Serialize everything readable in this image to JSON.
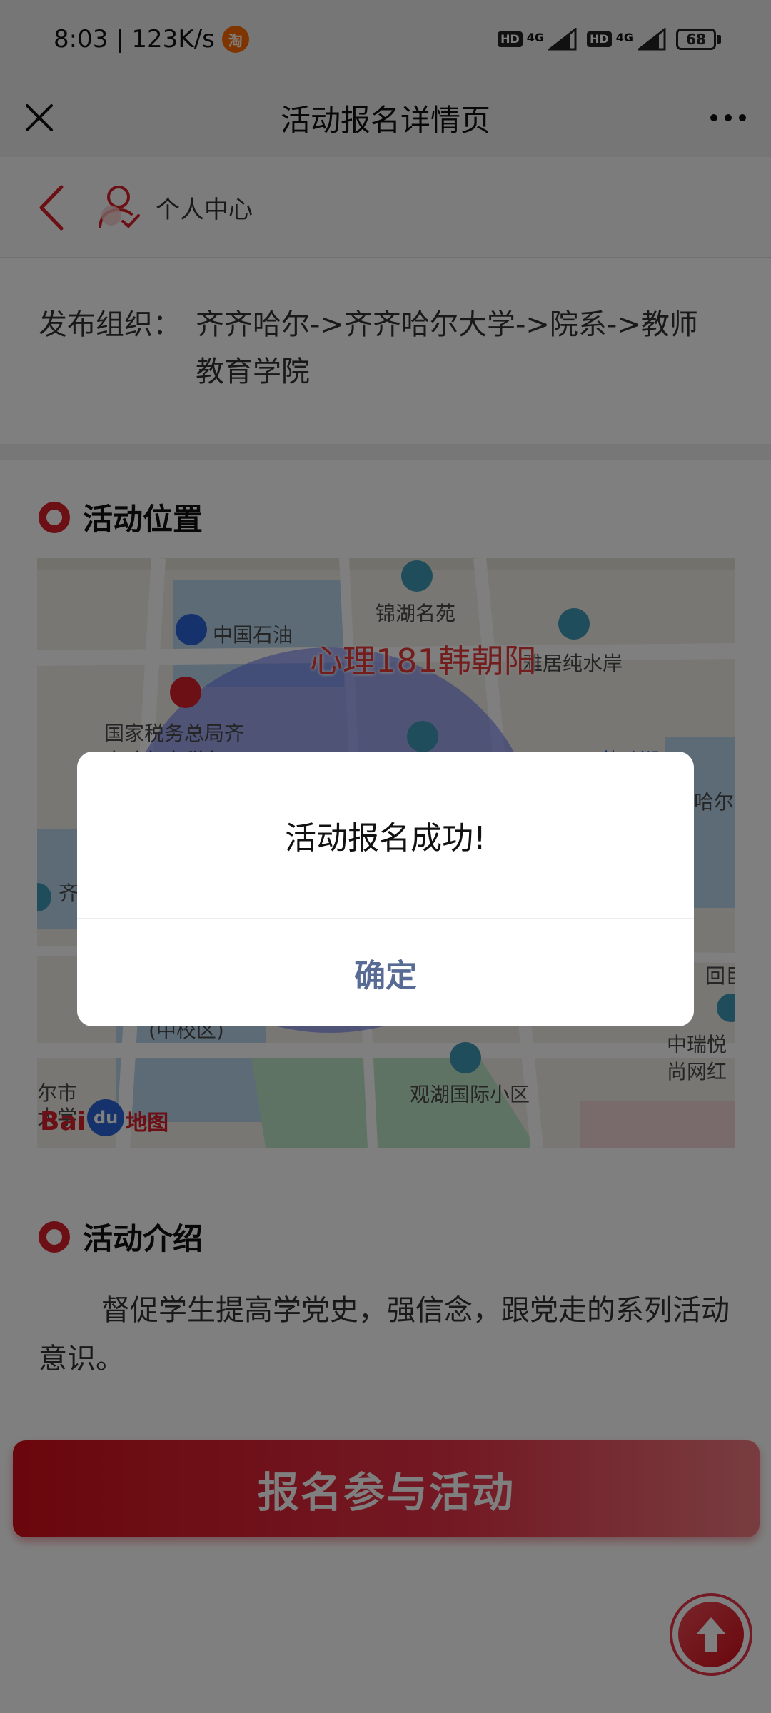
{
  "status_bar": {
    "time_speed": "8:03 | 123K/s",
    "taobao_badge": "淘",
    "hd_1": "HD",
    "net_1": "4G",
    "hd_2": "HD",
    "net_2": "4G",
    "battery": "68"
  },
  "title_bar": {
    "title": "活动报名详情页"
  },
  "sub_nav": {
    "label": "个人中心"
  },
  "org": {
    "label": "发布组织：",
    "value": "齐齐哈尔->齐齐哈尔大学->院系->教师教育学院"
  },
  "location_section": {
    "title": "活动位置"
  },
  "map": {
    "marker_label": "心理181韩朝阳",
    "labels": {
      "jinhu": "锦湖名苑",
      "sinopec": "中国石油",
      "yajuchun": "雅居纯水岸",
      "tax1": "国家税务总局齐",
      "tax2": "齐哈尔市税务局",
      "lake": "劳动湖",
      "haer": "哈尔",
      "qi": "齐",
      "zhongxiao": "(中校区)",
      "hui": "回巨",
      "zhongrui1": "中瑞悦",
      "zhongrui2": "尚网红",
      "guanhu": "观湖国际小区",
      "ershi": "尔市",
      "daxue": "大学"
    },
    "logo": {
      "bai": "Bai",
      "du": "du",
      "map_text": "地图"
    }
  },
  "intro_section": {
    "title": "活动介绍",
    "text": "督促学生提高学党史，强信念，跟党走的系列活动意识。"
  },
  "join_button": {
    "label": "报名参与活动"
  },
  "dialog": {
    "message": "活动报名成功!",
    "confirm_label": "确定"
  },
  "colors": {
    "accent_red": "#d8202a",
    "dialog_link": "#576b95"
  }
}
